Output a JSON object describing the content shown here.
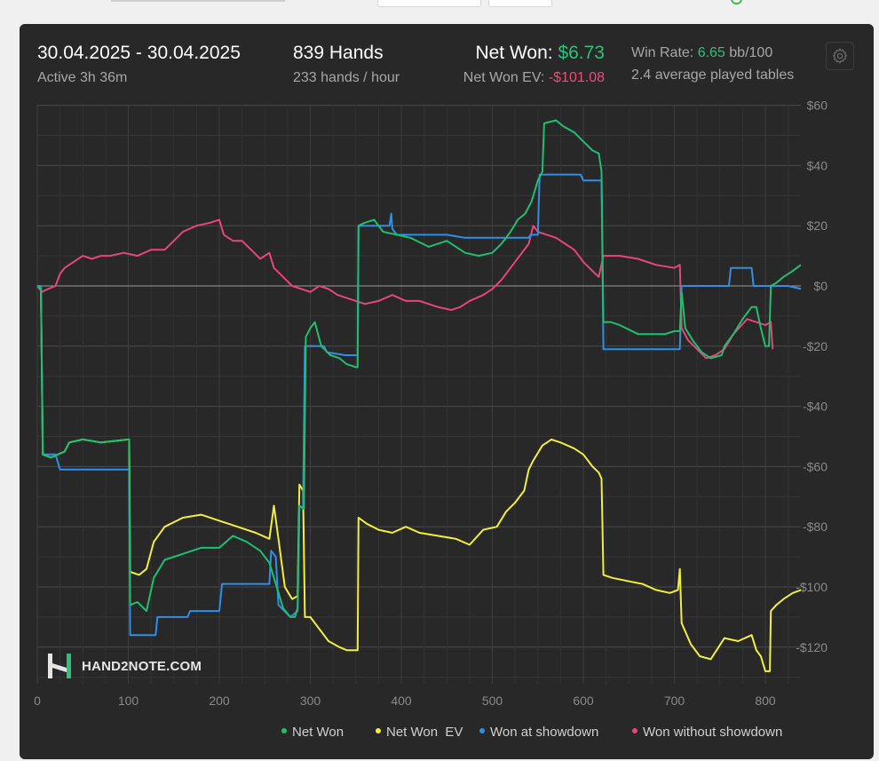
{
  "header": {
    "date_range": "30.04.2025 - 30.04.2025",
    "active": "Active 3h 36m",
    "hands": "839 Hands",
    "hands_per_hour": "233 hands / hour",
    "net_won_label": "Net Won: ",
    "net_won_value": "$6.73",
    "net_won_ev_label": "Net Won  EV: ",
    "net_won_ev_value": "-$101.08",
    "win_rate_label": "Win Rate: ",
    "win_rate_value": "6.65",
    "win_rate_unit": " bb/100",
    "avg_tables": "2.4 average played tables"
  },
  "logo": {
    "text": "HAND2NOTE.COM"
  },
  "colors": {
    "net_won": "#20bf70",
    "net_won_ev": "#f2ee3e",
    "showdown": "#2f8fe6",
    "no_showdown": "#e8457a",
    "grid": "#3c3c3c",
    "zero_line": "#9a9a9a"
  },
  "chart_data": {
    "type": "line",
    "xlim": [
      0,
      839
    ],
    "ylim": [
      -132,
      60
    ],
    "x_ticks": [
      0,
      100,
      200,
      300,
      400,
      500,
      600,
      700,
      800
    ],
    "y_ticks": [
      60,
      40,
      20,
      0,
      -20,
      -40,
      -60,
      -80,
      -100,
      -120
    ],
    "y_tick_labels": [
      "$60",
      "$40",
      "$20",
      "$0",
      "-$20",
      "-$40",
      "-$60",
      "-$80",
      "-$100",
      "-$120"
    ],
    "series": [
      {
        "name": "Net Won",
        "color": "#20bf70",
        "points": [
          [
            0,
            0
          ],
          [
            4,
            -1
          ],
          [
            6,
            -56
          ],
          [
            15,
            -57
          ],
          [
            30,
            -55
          ],
          [
            35,
            -52
          ],
          [
            50,
            -51
          ],
          [
            70,
            -52
          ],
          [
            100,
            -51
          ],
          [
            101,
            -51
          ],
          [
            102,
            -106
          ],
          [
            110,
            -105
          ],
          [
            120,
            -108
          ],
          [
            128,
            -97
          ],
          [
            140,
            -91
          ],
          [
            160,
            -89
          ],
          [
            180,
            -87
          ],
          [
            200,
            -87
          ],
          [
            215,
            -83
          ],
          [
            230,
            -85
          ],
          [
            245,
            -88
          ],
          [
            255,
            -92
          ],
          [
            262,
            -99
          ],
          [
            270,
            -107
          ],
          [
            278,
            -110
          ],
          [
            283,
            -110
          ],
          [
            286,
            -107
          ],
          [
            288,
            -73
          ],
          [
            293,
            -74
          ],
          [
            295,
            -17
          ],
          [
            300,
            -14
          ],
          [
            305,
            -12
          ],
          [
            312,
            -20
          ],
          [
            322,
            -23
          ],
          [
            332,
            -24
          ],
          [
            340,
            -26
          ],
          [
            350,
            -27
          ],
          [
            352,
            -27
          ],
          [
            353,
            20
          ],
          [
            360,
            21
          ],
          [
            370,
            22
          ],
          [
            380,
            18
          ],
          [
            395,
            17
          ],
          [
            410,
            16
          ],
          [
            430,
            13
          ],
          [
            450,
            15
          ],
          [
            470,
            11
          ],
          [
            485,
            10
          ],
          [
            500,
            11
          ],
          [
            510,
            14
          ],
          [
            520,
            18
          ],
          [
            528,
            22
          ],
          [
            536,
            24
          ],
          [
            543,
            28
          ],
          [
            550,
            35
          ],
          [
            555,
            38
          ],
          [
            557,
            54
          ],
          [
            570,
            55
          ],
          [
            578,
            53
          ],
          [
            590,
            51
          ],
          [
            600,
            48
          ],
          [
            610,
            45
          ],
          [
            617,
            44
          ],
          [
            620,
            38
          ],
          [
            622,
            -12
          ],
          [
            630,
            -12
          ],
          [
            640,
            -13
          ],
          [
            660,
            -16
          ],
          [
            675,
            -16
          ],
          [
            690,
            -16
          ],
          [
            700,
            -15
          ],
          [
            706,
            -15
          ],
          [
            708,
            -2
          ],
          [
            712,
            -14
          ],
          [
            720,
            -18
          ],
          [
            730,
            -22
          ],
          [
            740,
            -24
          ],
          [
            752,
            -23
          ],
          [
            755,
            -20
          ],
          [
            765,
            -16
          ],
          [
            775,
            -11
          ],
          [
            780,
            -9
          ],
          [
            785,
            -7
          ],
          [
            790,
            -7
          ],
          [
            795,
            -14
          ],
          [
            800,
            -20
          ],
          [
            804,
            -20
          ],
          [
            806,
            0
          ],
          [
            812,
            1
          ],
          [
            820,
            3
          ],
          [
            830,
            5
          ],
          [
            839,
            7
          ]
        ]
      },
      {
        "name": "Net Won  EV",
        "color": "#f2ee3e",
        "points": [
          [
            0,
            0
          ],
          [
            4,
            -1
          ],
          [
            6,
            -56
          ],
          [
            15,
            -57
          ],
          [
            30,
            -55
          ],
          [
            35,
            -52
          ],
          [
            50,
            -51
          ],
          [
            70,
            -52
          ],
          [
            100,
            -51
          ],
          [
            101,
            -51
          ],
          [
            102,
            -95
          ],
          [
            112,
            -96
          ],
          [
            120,
            -94
          ],
          [
            128,
            -85
          ],
          [
            140,
            -80
          ],
          [
            160,
            -77
          ],
          [
            180,
            -76
          ],
          [
            200,
            -78
          ],
          [
            220,
            -80
          ],
          [
            240,
            -82
          ],
          [
            255,
            -84
          ],
          [
            260,
            -73
          ],
          [
            265,
            -84
          ],
          [
            272,
            -100
          ],
          [
            280,
            -104
          ],
          [
            286,
            -103
          ],
          [
            288,
            -66
          ],
          [
            292,
            -68
          ],
          [
            294,
            -110
          ],
          [
            300,
            -110
          ],
          [
            310,
            -114
          ],
          [
            320,
            -118
          ],
          [
            332,
            -120
          ],
          [
            340,
            -121
          ],
          [
            352,
            -121
          ],
          [
            353,
            -77
          ],
          [
            362,
            -79
          ],
          [
            375,
            -81
          ],
          [
            390,
            -82
          ],
          [
            405,
            -80
          ],
          [
            420,
            -82
          ],
          [
            440,
            -83
          ],
          [
            460,
            -84
          ],
          [
            475,
            -86
          ],
          [
            490,
            -81
          ],
          [
            505,
            -80
          ],
          [
            515,
            -75
          ],
          [
            525,
            -72
          ],
          [
            535,
            -68
          ],
          [
            540,
            -61
          ],
          [
            545,
            -58
          ],
          [
            555,
            -53
          ],
          [
            565,
            -51
          ],
          [
            575,
            -52
          ],
          [
            590,
            -54
          ],
          [
            600,
            -56
          ],
          [
            610,
            -60
          ],
          [
            617,
            -62
          ],
          [
            620,
            -64
          ],
          [
            622,
            -96
          ],
          [
            632,
            -97
          ],
          [
            648,
            -98
          ],
          [
            665,
            -99
          ],
          [
            680,
            -101
          ],
          [
            695,
            -102
          ],
          [
            704,
            -101
          ],
          [
            706,
            -94
          ],
          [
            708,
            -112
          ],
          [
            718,
            -119
          ],
          [
            728,
            -123
          ],
          [
            740,
            -124
          ],
          [
            755,
            -117
          ],
          [
            770,
            -118
          ],
          [
            785,
            -116
          ],
          [
            790,
            -121
          ],
          [
            795,
            -123
          ],
          [
            800,
            -128
          ],
          [
            805,
            -128
          ],
          [
            806,
            -108
          ],
          [
            812,
            -106
          ],
          [
            820,
            -104
          ],
          [
            830,
            -102
          ],
          [
            839,
            -101
          ]
        ]
      },
      {
        "name": "Won at showdown",
        "color": "#2f8fe6",
        "points": [
          [
            0,
            0
          ],
          [
            4,
            0
          ],
          [
            6,
            -56
          ],
          [
            20,
            -56
          ],
          [
            25,
            -61
          ],
          [
            60,
            -61
          ],
          [
            100,
            -61
          ],
          [
            101,
            -61
          ],
          [
            102,
            -116
          ],
          [
            130,
            -116
          ],
          [
            132,
            -110
          ],
          [
            165,
            -110
          ],
          [
            168,
            -108
          ],
          [
            200,
            -108
          ],
          [
            203,
            -99
          ],
          [
            245,
            -99
          ],
          [
            248,
            -99
          ],
          [
            255,
            -99
          ],
          [
            257,
            -88
          ],
          [
            262,
            -90
          ],
          [
            265,
            -106
          ],
          [
            278,
            -110
          ],
          [
            286,
            -108
          ],
          [
            288,
            -73
          ],
          [
            292,
            -74
          ],
          [
            294,
            -20
          ],
          [
            315,
            -20
          ],
          [
            318,
            -22
          ],
          [
            338,
            -23
          ],
          [
            350,
            -23
          ],
          [
            352,
            -23
          ],
          [
            353,
            20
          ],
          [
            383,
            20
          ],
          [
            387,
            20
          ],
          [
            389,
            24
          ],
          [
            390,
            19
          ],
          [
            395,
            17
          ],
          [
            450,
            17
          ],
          [
            470,
            16
          ],
          [
            510,
            16
          ],
          [
            530,
            16
          ],
          [
            540,
            16
          ],
          [
            542,
            17
          ],
          [
            550,
            17
          ],
          [
            552,
            37
          ],
          [
            590,
            37
          ],
          [
            597,
            37
          ],
          [
            600,
            35
          ],
          [
            617,
            35
          ],
          [
            620,
            35
          ],
          [
            622,
            -21
          ],
          [
            660,
            -21
          ],
          [
            700,
            -21
          ],
          [
            706,
            -21
          ],
          [
            708,
            0
          ],
          [
            760,
            0
          ],
          [
            762,
            6
          ],
          [
            785,
            6
          ],
          [
            787,
            0
          ],
          [
            825,
            0
          ],
          [
            839,
            -1
          ]
        ]
      },
      {
        "name": "Won without showdown",
        "color": "#e8457a",
        "points": [
          [
            0,
            0
          ],
          [
            5,
            -2
          ],
          [
            12,
            -1
          ],
          [
            20,
            0
          ],
          [
            25,
            4
          ],
          [
            30,
            6
          ],
          [
            40,
            8
          ],
          [
            50,
            10
          ],
          [
            60,
            9
          ],
          [
            70,
            10
          ],
          [
            80,
            10
          ],
          [
            95,
            11
          ],
          [
            110,
            10
          ],
          [
            125,
            12
          ],
          [
            140,
            12
          ],
          [
            150,
            15
          ],
          [
            160,
            18
          ],
          [
            175,
            20
          ],
          [
            190,
            21
          ],
          [
            200,
            22
          ],
          [
            205,
            17
          ],
          [
            215,
            15
          ],
          [
            225,
            15
          ],
          [
            235,
            12
          ],
          [
            245,
            9
          ],
          [
            255,
            11
          ],
          [
            260,
            6
          ],
          [
            270,
            3
          ],
          [
            280,
            0
          ],
          [
            290,
            -1
          ],
          [
            300,
            -2
          ],
          [
            310,
            0
          ],
          [
            320,
            -1
          ],
          [
            330,
            -3
          ],
          [
            340,
            -4
          ],
          [
            350,
            -5
          ],
          [
            360,
            -6
          ],
          [
            375,
            -5
          ],
          [
            390,
            -3
          ],
          [
            405,
            -5
          ],
          [
            420,
            -5
          ],
          [
            440,
            -7
          ],
          [
            455,
            -8
          ],
          [
            465,
            -7
          ],
          [
            475,
            -5
          ],
          [
            490,
            -3
          ],
          [
            500,
            -1
          ],
          [
            510,
            2
          ],
          [
            520,
            6
          ],
          [
            530,
            10
          ],
          [
            540,
            14
          ],
          [
            545,
            20
          ],
          [
            550,
            18
          ],
          [
            560,
            17
          ],
          [
            570,
            16
          ],
          [
            580,
            14
          ],
          [
            590,
            12
          ],
          [
            600,
            8
          ],
          [
            610,
            5
          ],
          [
            617,
            3
          ],
          [
            622,
            10
          ],
          [
            640,
            10
          ],
          [
            660,
            9
          ],
          [
            680,
            7
          ],
          [
            700,
            6
          ],
          [
            706,
            7
          ],
          [
            708,
            -14
          ],
          [
            715,
            -18
          ],
          [
            725,
            -21
          ],
          [
            735,
            -24
          ],
          [
            745,
            -23
          ],
          [
            755,
            -21
          ],
          [
            765,
            -16
          ],
          [
            780,
            -11
          ],
          [
            790,
            -12
          ],
          [
            800,
            -13
          ],
          [
            806,
            -12
          ],
          [
            808,
            -21
          ]
        ]
      }
    ]
  }
}
